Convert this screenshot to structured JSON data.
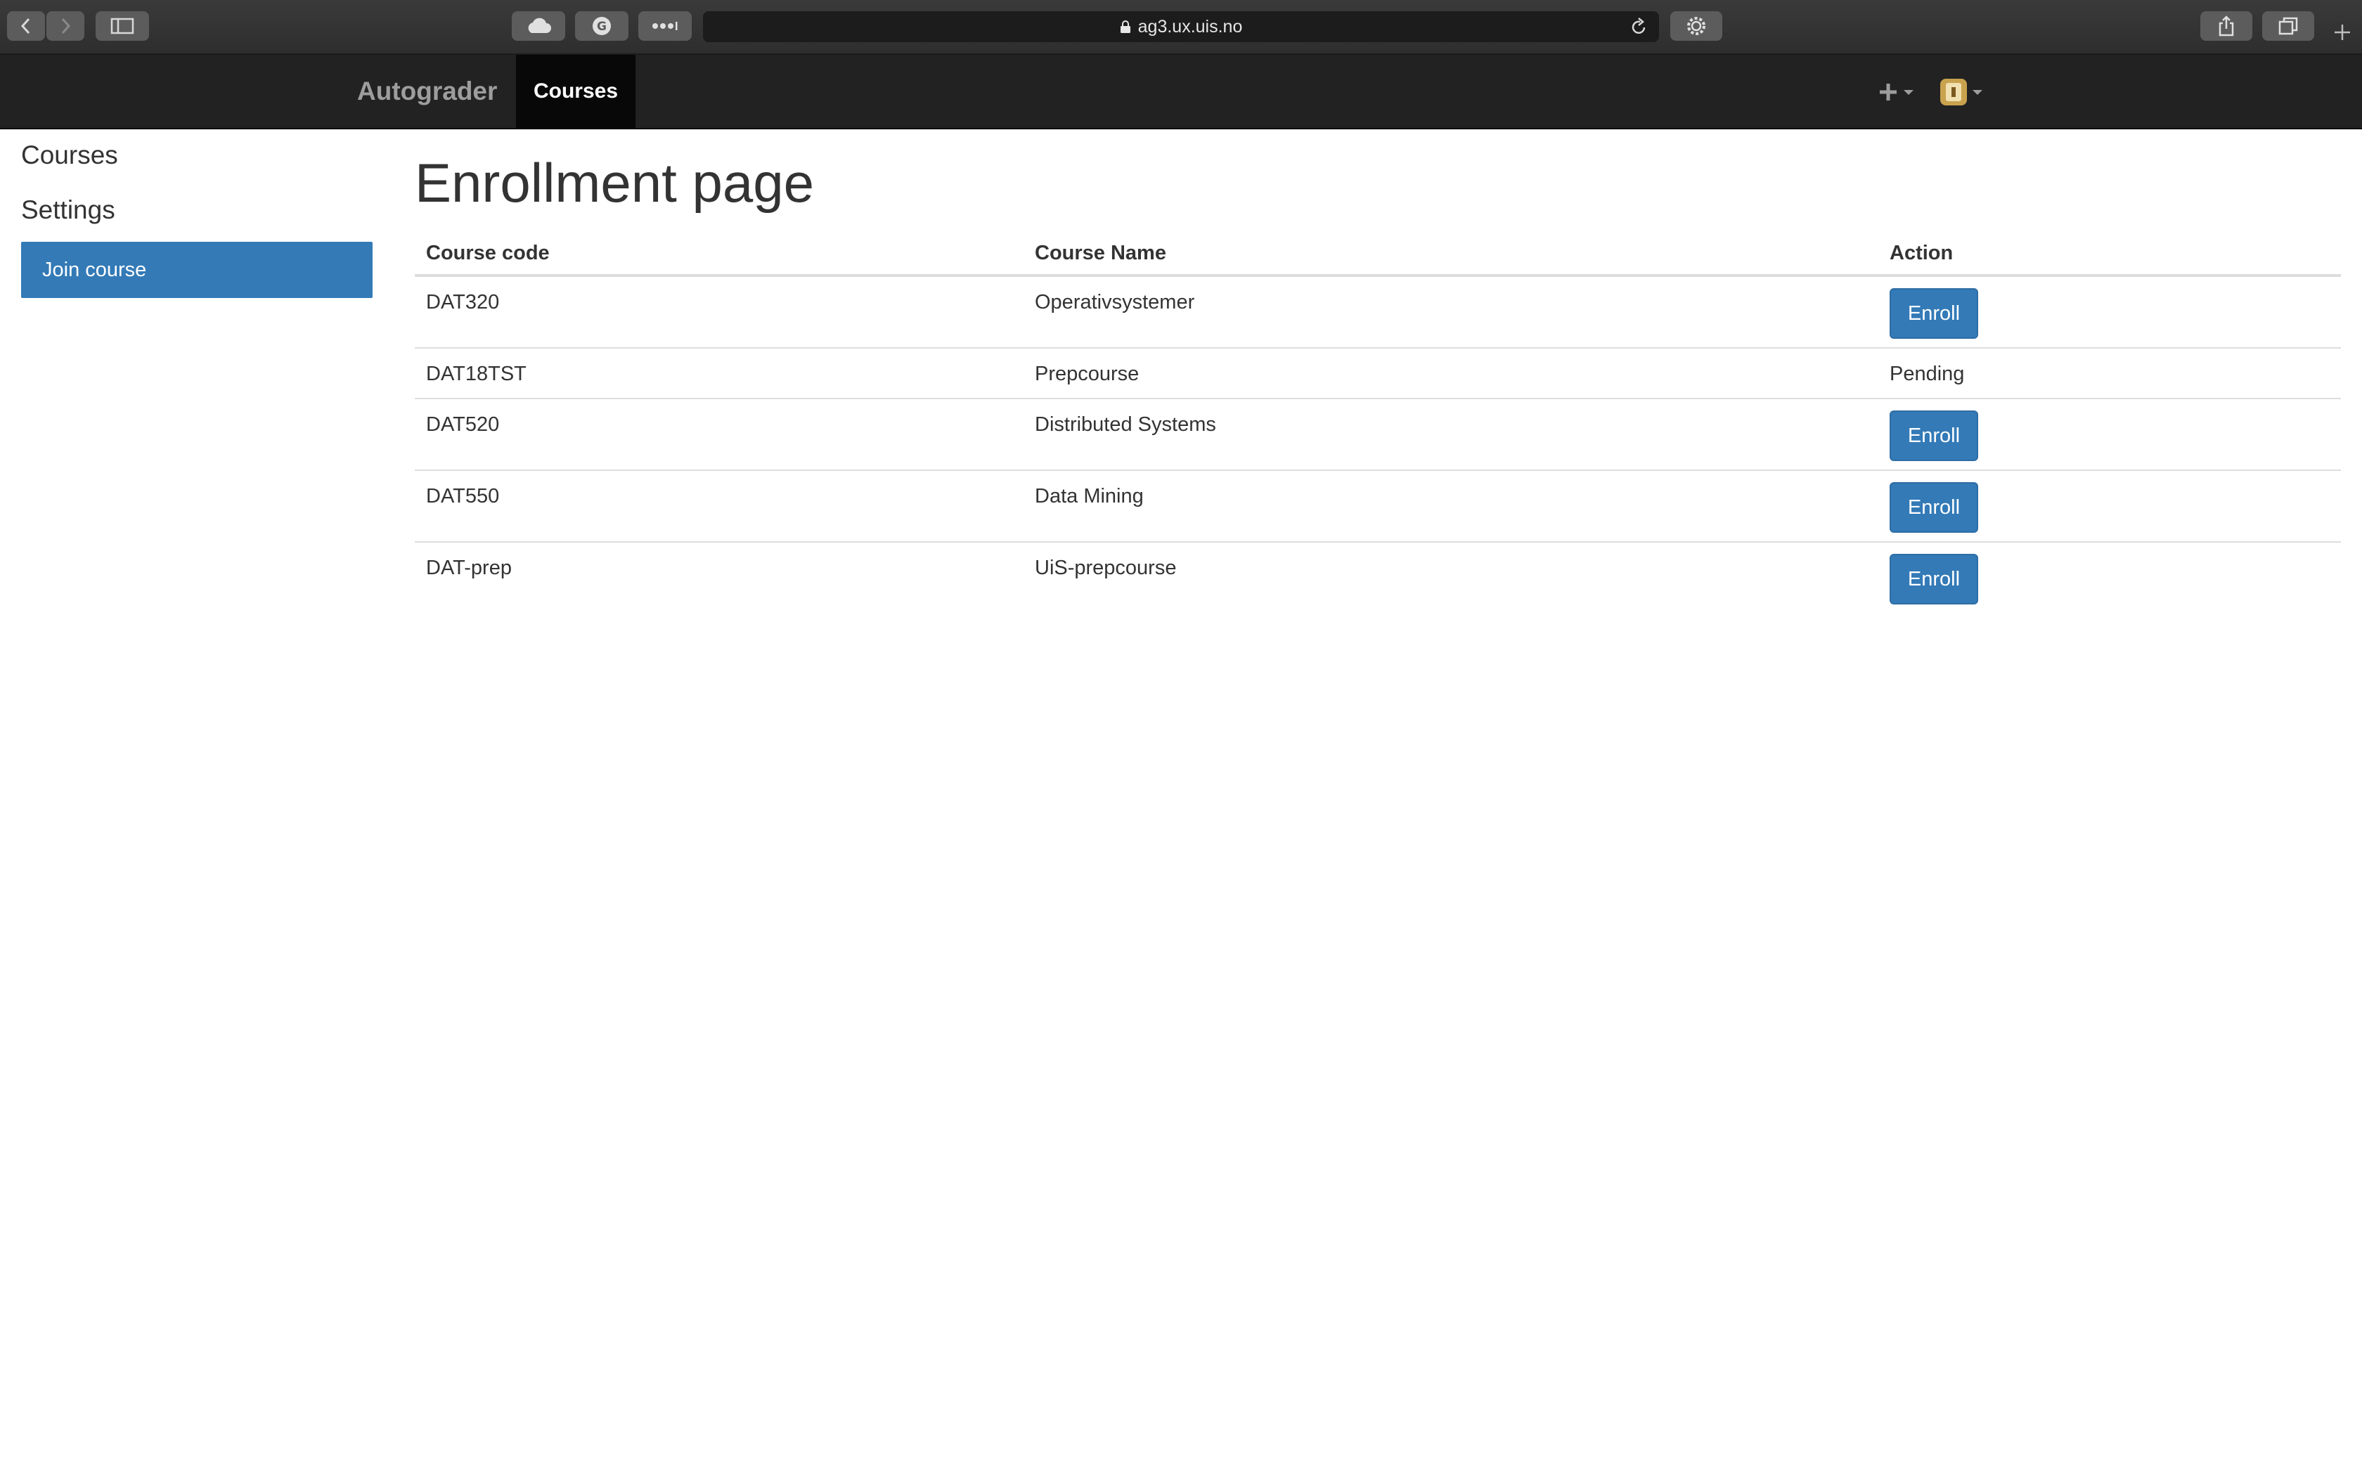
{
  "browser": {
    "url": "ag3.ux.uis.no"
  },
  "navbar": {
    "brand": "Autograder",
    "active_tab": "Courses"
  },
  "sidebar": {
    "headings": [
      "Courses",
      "Settings"
    ],
    "active_item": "Join course"
  },
  "main": {
    "title": "Enrollment page",
    "columns": [
      "Course code",
      "Course Name",
      "Action"
    ],
    "rows": [
      {
        "code": "DAT320",
        "name": "Operativsystemer",
        "action": "Enroll",
        "action_type": "button"
      },
      {
        "code": "DAT18TST",
        "name": "Prepcourse",
        "action": "Pending",
        "action_type": "text"
      },
      {
        "code": "DAT520",
        "name": "Distributed Systems",
        "action": "Enroll",
        "action_type": "button"
      },
      {
        "code": "DAT550",
        "name": "Data Mining",
        "action": "Enroll",
        "action_type": "button"
      },
      {
        "code": "DAT-prep",
        "name": "UiS-prepcourse",
        "action": "Enroll",
        "action_type": "button"
      }
    ]
  },
  "colors": {
    "primary": "#337ab7",
    "navbar": "#222222",
    "navbar_active": "#080808"
  }
}
